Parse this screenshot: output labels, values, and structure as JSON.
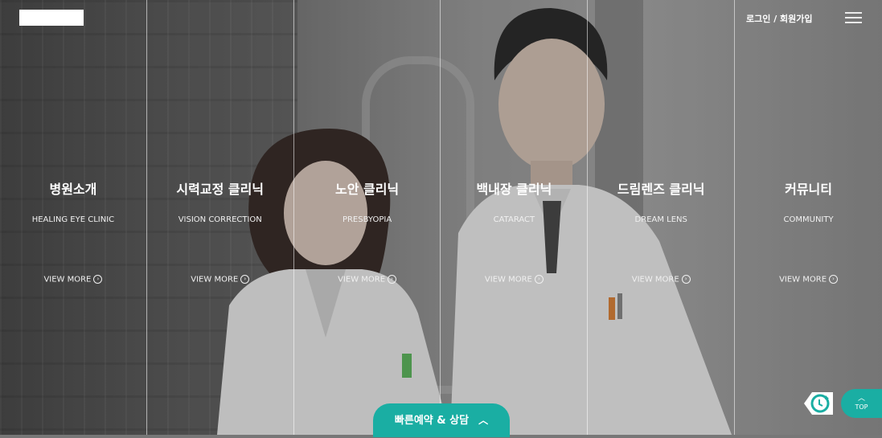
{
  "header": {
    "login_label": "로그인 / 회원가입"
  },
  "columns": [
    {
      "title": "병원소개",
      "subtitle": "HEALING EYE CLINIC",
      "more": "VIEW MORE"
    },
    {
      "title": "시력교정 클리닉",
      "subtitle": "VISION CORRECTION",
      "more": "VIEW MORE"
    },
    {
      "title": "노안 클리닉",
      "subtitle": "PRESBYOPIA",
      "more": "VIEW MORE"
    },
    {
      "title": "백내장 클리닉",
      "subtitle": "CATARACT",
      "more": "VIEW MORE"
    },
    {
      "title": "드림렌즈 클리닉",
      "subtitle": "DREAM LENS",
      "more": "VIEW MORE"
    },
    {
      "title": "커뮤니티",
      "subtitle": "COMMUNITY",
      "more": "VIEW MORE"
    }
  ],
  "quick_reserve": {
    "label": "빠른예약 & 상담"
  },
  "top_button": {
    "label": "TOP"
  },
  "icons": {
    "more": "arrow-circle-icon",
    "menu": "hamburger-icon",
    "reset": "refresh-icon"
  },
  "colors": {
    "accent": "#1aaea3"
  }
}
